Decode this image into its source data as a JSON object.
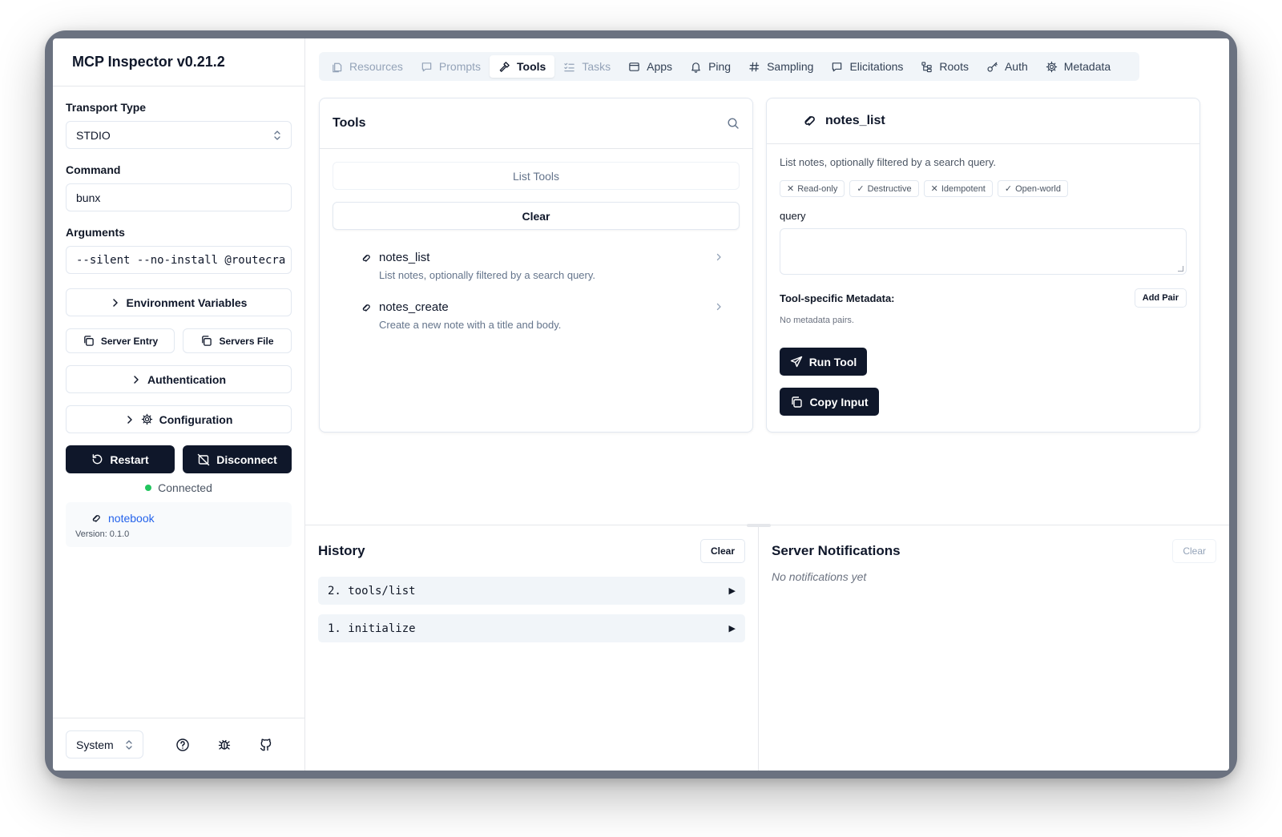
{
  "app": {
    "title": "MCP Inspector v0.21.2"
  },
  "sidebar": {
    "transport_label": "Transport Type",
    "transport_value": "STDIO",
    "command_label": "Command",
    "command_value": "bunx",
    "arguments_label": "Arguments",
    "arguments_value": "--silent --no-install @routecra",
    "env_vars_label": "Environment Variables",
    "server_entry_label": "Server Entry",
    "servers_file_label": "Servers File",
    "authentication_label": "Authentication",
    "configuration_label": "Configuration",
    "restart_label": "Restart",
    "disconnect_label": "Disconnect",
    "status_text": "Connected",
    "status_color": "#22c55e",
    "server": {
      "name": "notebook",
      "version": "Version: 0.1.0"
    },
    "theme_value": "System"
  },
  "tabs": [
    {
      "label": "Resources",
      "icon": "files-icon",
      "state": "disabled"
    },
    {
      "label": "Prompts",
      "icon": "message-square-icon",
      "state": "disabled"
    },
    {
      "label": "Tools",
      "icon": "hammer-icon",
      "state": "active"
    },
    {
      "label": "Tasks",
      "icon": "list-checks-icon",
      "state": "disabled"
    },
    {
      "label": "Apps",
      "icon": "app-window-icon",
      "state": "normal"
    },
    {
      "label": "Ping",
      "icon": "bell-icon",
      "state": "normal"
    },
    {
      "label": "Sampling",
      "icon": "hash-icon",
      "state": "normal"
    },
    {
      "label": "Elicitations",
      "icon": "message-square-icon",
      "state": "normal"
    },
    {
      "label": "Roots",
      "icon": "folder-tree-icon",
      "state": "normal"
    },
    {
      "label": "Auth",
      "icon": "key-icon",
      "state": "normal"
    },
    {
      "label": "Metadata",
      "icon": "gear-icon",
      "state": "normal"
    }
  ],
  "tools_panel": {
    "title": "Tools",
    "list_tools_label": "List Tools",
    "clear_label": "Clear",
    "items": [
      {
        "name": "notes_list",
        "description": "List notes, optionally filtered by a search query."
      },
      {
        "name": "notes_create",
        "description": "Create a new note with a title and body."
      }
    ]
  },
  "tool_detail": {
    "title": "notes_list",
    "description": "List notes, optionally filtered by a search query.",
    "annotations": [
      {
        "mark": "✕",
        "label": "Read-only"
      },
      {
        "mark": "✓",
        "label": "Destructive"
      },
      {
        "mark": "✕",
        "label": "Idempotent"
      },
      {
        "mark": "✓",
        "label": "Open-world"
      }
    ],
    "param_label": "query",
    "param_value": "",
    "metadata_title": "Tool-specific Metadata:",
    "add_pair_label": "Add Pair",
    "metadata_empty": "No metadata pairs.",
    "run_label": "Run Tool",
    "copy_label": "Copy Input"
  },
  "history": {
    "title": "History",
    "clear_label": "Clear",
    "items": [
      {
        "label": "2. tools/list",
        "arrow": "▶"
      },
      {
        "label": "1. initialize",
        "arrow": "▶"
      }
    ]
  },
  "notifications": {
    "title": "Server Notifications",
    "clear_label": "Clear",
    "empty_text": "No notifications yet"
  },
  "colors": {
    "primary_dark": "#0f172a",
    "link_blue": "#2563eb",
    "border": "#e2e8f0"
  }
}
